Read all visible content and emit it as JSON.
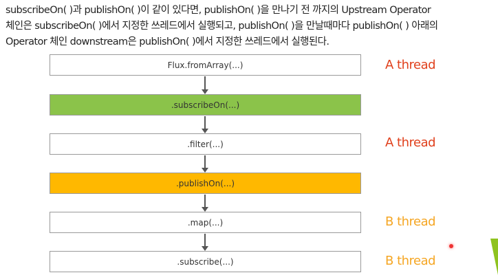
{
  "description": [
    "subscribeOn( )과 publishOn( )이 같이 있다면, publishOn( )을 만나기 전 까지의 Upstream Operator",
    "체인은 subscribeOn( )에서 지정한 쓰레드에서 실행되고, publishOn( )을 만날때마다 publishOn( ) 아래의",
    "Operator 체인 downstream은 publishOn( )에서 지정한 쓰레드에서 실행된다."
  ],
  "operators": [
    {
      "label": "Flux.fromArray(...)",
      "color": "#ffffff"
    },
    {
      "label": ".subscribeOn(...)",
      "color": "#8bc34a"
    },
    {
      "label": ".filter(...)",
      "color": "#ffffff"
    },
    {
      "label": ".publishOn(...)",
      "color": "#ffb800"
    },
    {
      "label": ".map(...)",
      "color": "#ffffff"
    },
    {
      "label": ".subscribe(...)",
      "color": "#ffffff"
    }
  ],
  "thread_labels": [
    {
      "label": "A thread",
      "color": "#e0401c"
    },
    {
      "label": "A thread",
      "color": "#e0401c"
    },
    {
      "label": "B thread",
      "color": "#f5a623"
    },
    {
      "label": "B thread",
      "color": "#f5a623"
    }
  ]
}
